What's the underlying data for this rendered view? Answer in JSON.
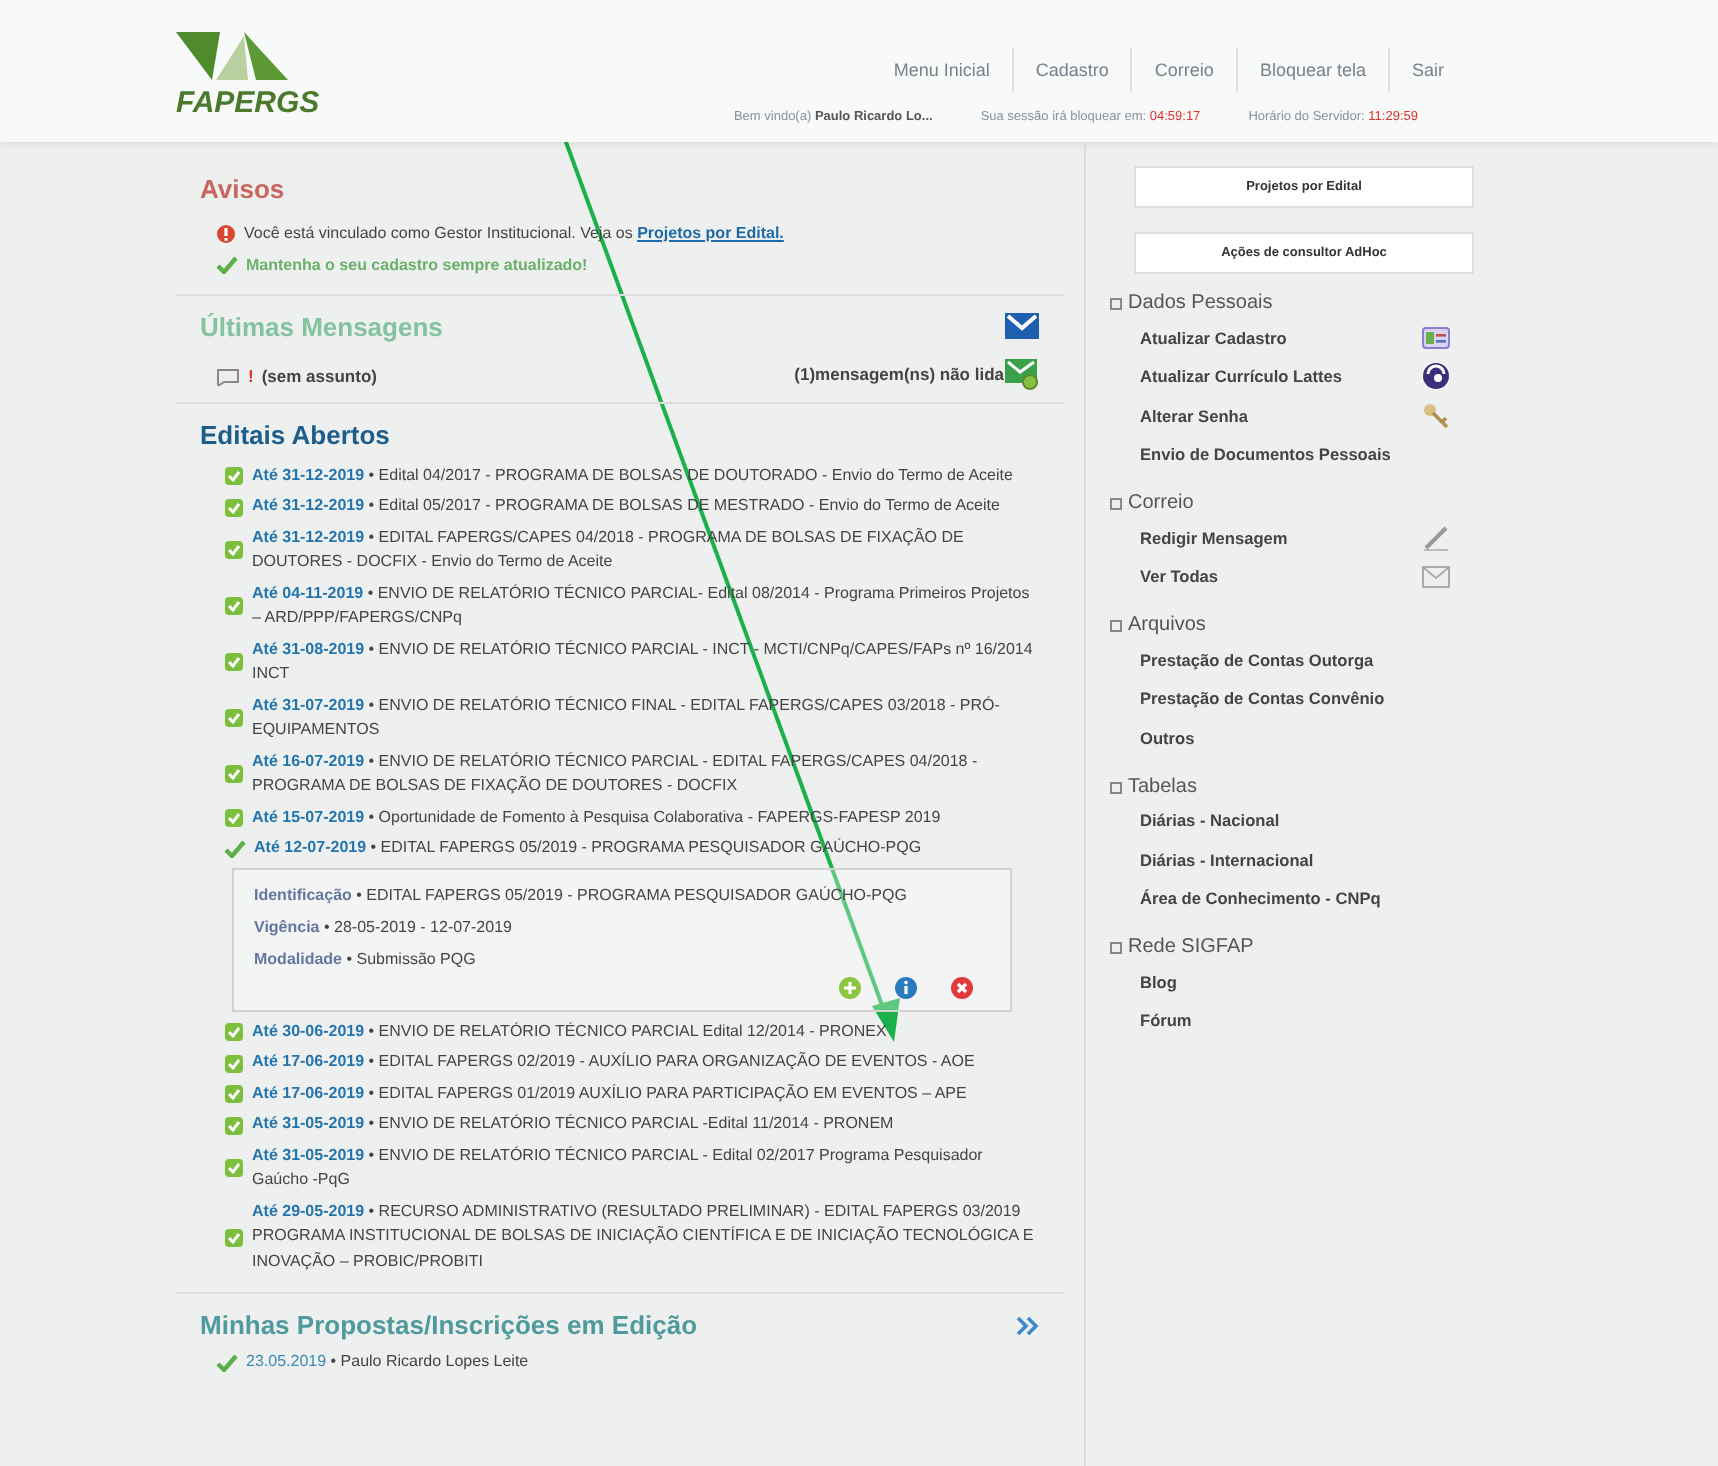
{
  "header": {
    "logo": "FAPERGS",
    "nav": [
      "Menu Inicial",
      "Cadastro",
      "Correio",
      "Bloquear tela",
      "Sair"
    ],
    "welcome_label": "Bem vindo(a)",
    "user": "Paulo Ricardo Lo...",
    "session_label": "Sua sessão irá bloquear em:",
    "session_time": "04:59:17",
    "server_label": "Horário do Servidor:",
    "server_time": "11:29:59"
  },
  "avisos": {
    "title": "Avisos",
    "items": [
      {
        "kind": "warning",
        "text": "Você está vinculado como Gestor Institucional. Veja os ",
        "link": "Projetos por Edital."
      },
      {
        "kind": "ok",
        "text": "Mantenha o seu cadastro sempre atualizado!"
      }
    ]
  },
  "mensagens": {
    "title": "Últimas Mensagens",
    "items": [
      {
        "flag": "!",
        "subject": "(sem assunto)"
      }
    ],
    "unread": "(1)mensagem(ns) não lida"
  },
  "editais": {
    "title": "Editais Abertos",
    "items": [
      {
        "date": "Até 31-12-2019",
        "text": "• Edital 04/2017 - PROGRAMA DE BOLSAS DE DOUTORADO - Envio do Termo de Aceite",
        "expanded": false
      },
      {
        "date": "Até 31-12-2019",
        "text": "• Edital 05/2017 - PROGRAMA DE BOLSAS DE MESTRADO - Envio do Termo de Aceite",
        "expanded": false
      },
      {
        "date": "Até 31-12-2019",
        "text": "• EDITAL FAPERGS/CAPES 04/2018 - PROGRAMA DE BOLSAS DE FIXAÇÃO DE DOUTORES - DOCFIX - Envio do Termo de Aceite",
        "expanded": false
      },
      {
        "date": "Até 04-11-2019",
        "text": "• ENVIO DE RELATÓRIO TÉCNICO PARCIAL- Edital 08/2014 - Programa Primeiros Projetos – ARD/PPP/FAPERGS/CNPq",
        "expanded": false
      },
      {
        "date": "Até 31-08-2019",
        "text": "• ENVIO DE RELATÓRIO TÉCNICO PARCIAL - INCT - MCTI/CNPq/CAPES/FAPs nº 16/2014 INCT",
        "expanded": false
      },
      {
        "date": "Até 31-07-2019",
        "text": "• ENVIO DE RELATÓRIO TÉCNICO FINAL - EDITAL FAPERGS/CAPES 03/2018 - PRÓ-EQUIPAMENTOS",
        "expanded": false
      },
      {
        "date": "Até 16-07-2019",
        "text": "• ENVIO DE RELATÓRIO TÉCNICO PARCIAL - EDITAL FAPERGS/CAPES 04/2018 - PROGRAMA DE BOLSAS DE FIXAÇÃO DE DOUTORES - DOCFIX",
        "expanded": false
      },
      {
        "date": "Até 15-07-2019",
        "text": "• Oportunidade de Fomento à Pesquisa Colaborativa - FAPERGS-FAPESP 2019",
        "expanded": false
      },
      {
        "date": "Até 12-07-2019",
        "text": "• EDITAL FAPERGS 05/2019 - PROGRAMA PESQUISADOR GAÚCHO-PQG",
        "expanded": true,
        "details": [
          {
            "label": "Identificação",
            "value": "• EDITAL FAPERGS 05/2019 - PROGRAMA PESQUISADOR GAÚCHO-PQG"
          },
          {
            "label": "Vigência",
            "value": "• 28-05-2019 - 12-07-2019"
          },
          {
            "label": "Modalidade",
            "value": "• Submissão PQG"
          }
        ]
      },
      {
        "date": "Até 30-06-2019",
        "text": "• ENVIO DE RELATÓRIO TÉCNICO PARCIAL Edital 12/2014 - PRONEX",
        "expanded": false
      },
      {
        "date": "Até 17-06-2019",
        "text": "• EDITAL FAPERGS 02/2019 - AUXÍLIO PARA ORGANIZAÇÃO DE EVENTOS - AOE",
        "expanded": false
      },
      {
        "date": "Até 17-06-2019",
        "text": "• EDITAL FAPERGS 01/2019 AUXÍLIO PARA PARTICIPAÇÃO EM EVENTOS – APE",
        "expanded": false
      },
      {
        "date": "Até 31-05-2019",
        "text": "• ENVIO DE RELATÓRIO TÉCNICO PARCIAL -Edital 11/2014 - PRONEM",
        "expanded": false
      },
      {
        "date": "Até 31-05-2019",
        "text": "• ENVIO DE RELATÓRIO TÉCNICO PARCIAL - Edital 02/2017 Programa Pesquisador Gaúcho -PqG",
        "expanded": false
      },
      {
        "date": "Até 29-05-2019",
        "text": "• RECURSO ADMINISTRATIVO (RESULTADO PRELIMINAR) - EDITAL FAPERGS 03/2019 PROGRAMA INSTITUCIONAL DE BOLSAS DE INICIAÇÃO CIENTÍFICA E DE INICIAÇÃO TECNOLÓGICA E INOVAÇÃO – PROBIC/PROBITI",
        "expanded": false
      }
    ]
  },
  "propostas": {
    "title": "Minhas Propostas/Inscrições em Edição",
    "items": [
      {
        "date": "23.05.2019",
        "text": "• Paulo Ricardo Lopes Leite"
      }
    ]
  },
  "sidebar": {
    "buttons": [
      "Projetos por Edital",
      "Ações de consultor AdHoc"
    ],
    "groups": [
      {
        "title": "Dados Pessoais",
        "links": [
          {
            "label": "Atualizar Cadastro",
            "kind": "card"
          },
          {
            "label": "Atualizar Currículo Lattes",
            "kind": "globe"
          },
          {
            "label": "Alterar Senha",
            "kind": "key"
          },
          {
            "label": "Envio de Documentos Pessoais"
          }
        ]
      },
      {
        "title": "Correio",
        "links": [
          {
            "label": "Redigir Mensagem",
            "kind": "pen"
          },
          {
            "label": "Ver Todas",
            "kind": "mail"
          }
        ]
      },
      {
        "title": "Arquivos",
        "links": [
          {
            "label": "Prestação de Contas Outorga"
          },
          {
            "label": "Prestação de Contas Convênio"
          },
          {
            "label": "Outros"
          }
        ]
      },
      {
        "title": "Tabelas",
        "links": [
          {
            "label": "Diárias - Nacional"
          },
          {
            "label": "Diárias - Internacional"
          },
          {
            "label": "Área de Conhecimento - CNPq"
          }
        ]
      },
      {
        "title": "Rede SIGFAP",
        "links": [
          {
            "label": "Blog"
          },
          {
            "label": "Fórum"
          }
        ]
      }
    ]
  }
}
